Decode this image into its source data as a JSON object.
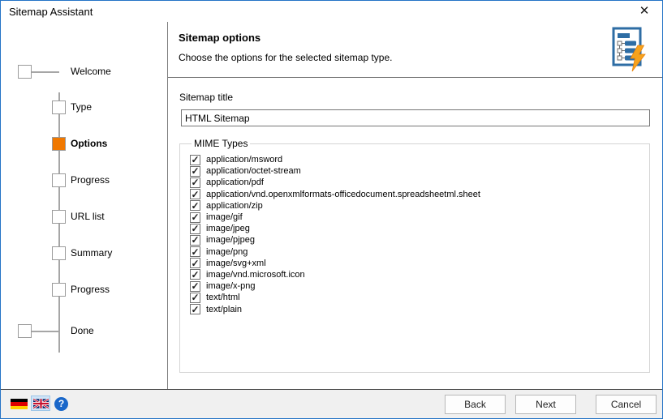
{
  "window": {
    "title": "Sitemap Assistant",
    "close_icon": "✕"
  },
  "sidebar": {
    "active_color": "#f07800",
    "steps": [
      {
        "label": "Welcome",
        "state": "edge"
      },
      {
        "label": "Type",
        "state": "pending"
      },
      {
        "label": "Options",
        "state": "active"
      },
      {
        "label": "Progress",
        "state": "pending"
      },
      {
        "label": "URL list",
        "state": "pending"
      },
      {
        "label": "Summary",
        "state": "pending"
      },
      {
        "label": "Progress",
        "state": "pending"
      },
      {
        "label": "Done",
        "state": "edge"
      }
    ]
  },
  "header": {
    "title": "Sitemap options",
    "subtitle": "Choose the options for the selected sitemap type.",
    "icon": "sitemap-lightning-icon",
    "icon_blue": "#2e6da4",
    "icon_bolt": "#f6a21d"
  },
  "form": {
    "sitemap_title_label": "Sitemap title",
    "sitemap_title_value": "HTML Sitemap",
    "mime_group_label": "MIME Types",
    "mime_all_checked": true,
    "mime_types": [
      "application/msword",
      "application/octet-stream",
      "application/pdf",
      "application/vnd.openxmlformats-officedocument.spreadsheetml.sheet",
      "application/zip",
      "image/gif",
      "image/jpeg",
      "image/pjpeg",
      "image/png",
      "image/svg+xml",
      "image/vnd.microsoft.icon",
      "image/x-png",
      "text/html",
      "text/plain"
    ]
  },
  "footer": {
    "back_label": "Back",
    "next_label": "Next",
    "cancel_label": "Cancel",
    "help_icon": "?",
    "languages": [
      {
        "icon": "german-flag",
        "selected": false
      },
      {
        "icon": "uk-flag",
        "selected": true
      }
    ]
  }
}
